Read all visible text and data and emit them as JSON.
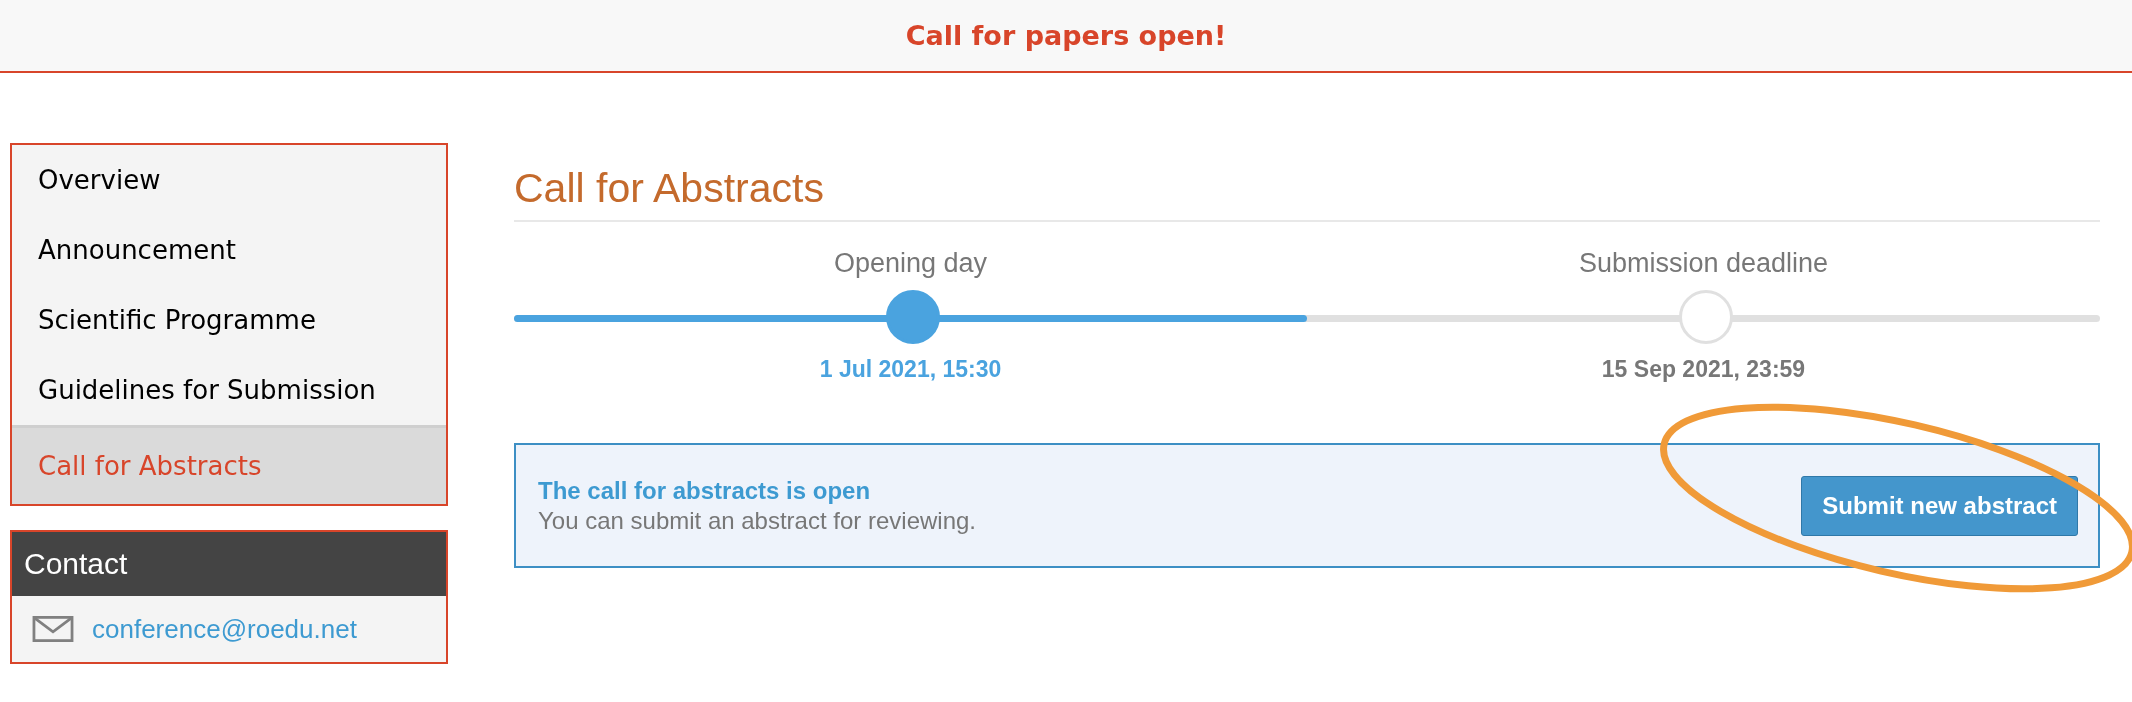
{
  "banner": {
    "text": "Call for papers open!"
  },
  "sidebar": {
    "items": [
      {
        "label": "Overview",
        "selected": false
      },
      {
        "label": "Announcement",
        "selected": false
      },
      {
        "label": "Scientific Programme",
        "selected": false
      },
      {
        "label": "Guidelines for Submission",
        "selected": false
      },
      {
        "label": "Call for Abstracts",
        "selected": true
      }
    ]
  },
  "contact": {
    "title": "Contact",
    "email": "conference@roedu.net"
  },
  "page": {
    "title": "Call for Abstracts"
  },
  "timeline": {
    "level": 0.5,
    "milestones": [
      {
        "label": "Opening day",
        "date": "1 Jul 2021, 15:30",
        "reached": true
      },
      {
        "label": "Submission deadline",
        "date": "15 Sep 2021, 23:59",
        "reached": false
      }
    ]
  },
  "alert": {
    "title": "The call for abstracts is open",
    "text": "You can submit an abstract for reviewing.",
    "button": "Submit new abstract"
  },
  "annotation": {
    "kind": "ellipse"
  }
}
